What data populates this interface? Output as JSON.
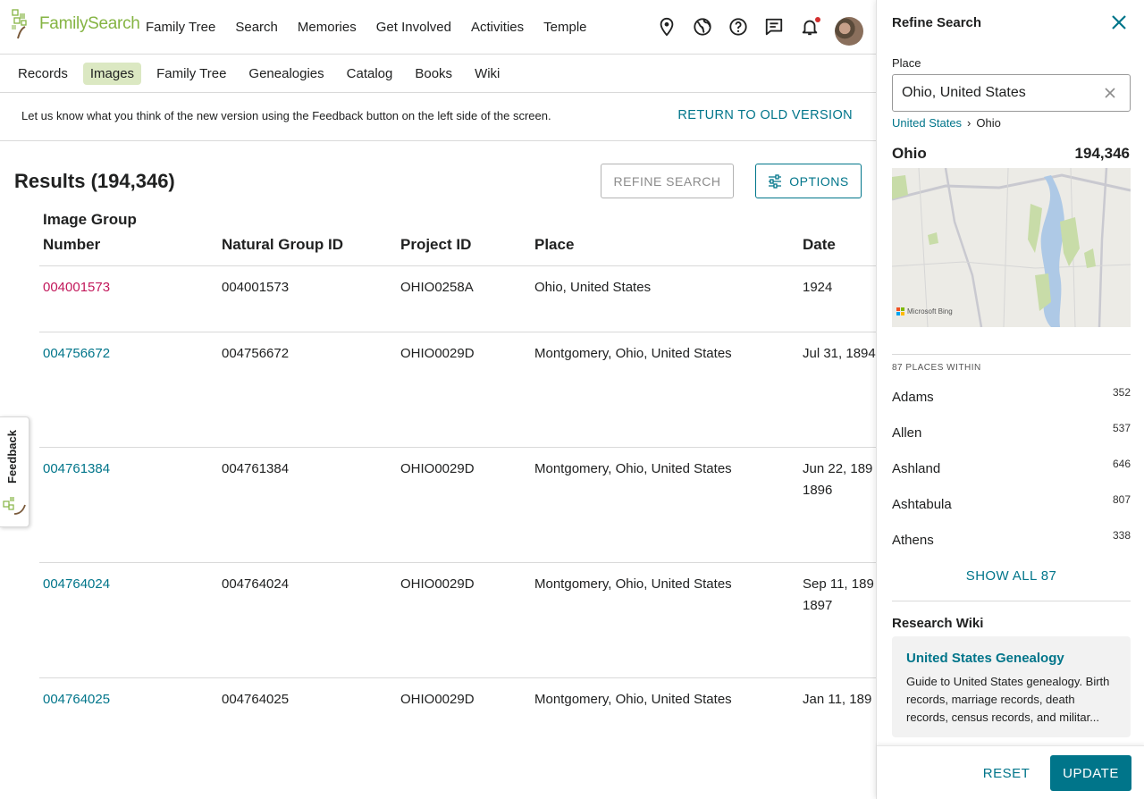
{
  "header": {
    "logo_text": "FamilySearch",
    "nav": [
      "Family Tree",
      "Search",
      "Memories",
      "Get Involved",
      "Activities",
      "Temple"
    ],
    "icons": [
      "location-pin-icon",
      "globe-icon",
      "help-icon",
      "messages-icon",
      "notifications-icon"
    ]
  },
  "subnav": {
    "items": [
      "Records",
      "Images",
      "Family Tree",
      "Genealogies",
      "Catalog",
      "Books",
      "Wiki"
    ],
    "active": "Images"
  },
  "banner": {
    "text": "Let us know what you think of the new version using the Feedback button on the left side of the screen.",
    "link": "RETURN TO OLD VERSION"
  },
  "results": {
    "title": "Results (194,346)",
    "refine_button": "REFINE SEARCH",
    "options_button": "OPTIONS",
    "columns": [
      "Image Group Number",
      "Natural Group ID",
      "Project ID",
      "Place",
      "Date"
    ],
    "rows": [
      {
        "group": "004001573",
        "natural": "004001573",
        "project": "OHIO0258A",
        "place": "Ohio, United States",
        "date": "1924",
        "date2": "",
        "visited": true
      },
      {
        "group": "004756672",
        "natural": "004756672",
        "project": "OHIO0029D",
        "place": "Montgomery, Ohio, United States",
        "date": "Jul 31, 1894",
        "date2": "",
        "visited": false
      },
      {
        "group": "004761384",
        "natural": "004761384",
        "project": "OHIO0029D",
        "place": "Montgomery, Ohio, United States",
        "date": "Jun 22, 189",
        "date2": "1896",
        "visited": false
      },
      {
        "group": "004764024",
        "natural": "004764024",
        "project": "OHIO0029D",
        "place": "Montgomery, Ohio, United States",
        "date": "Sep 11, 189",
        "date2": "1897",
        "visited": false
      },
      {
        "group": "004764025",
        "natural": "004764025",
        "project": "OHIO0029D",
        "place": "Montgomery, Ohio, United States",
        "date": "Jan 11, 189",
        "date2": "",
        "visited": false
      }
    ]
  },
  "feedback_tab": {
    "label": "Feedback"
  },
  "panel": {
    "title": "Refine Search",
    "place_label": "Place",
    "place_value": "Ohio, United States",
    "breadcrumb": {
      "parent": "United States",
      "separator": "›",
      "current": "Ohio"
    },
    "place_name": "Ohio",
    "place_count": "194,346",
    "map_brand": "Microsoft Bing",
    "places_within_label": "87 PLACES WITHIN",
    "counties": [
      {
        "name": "Adams",
        "count": "352"
      },
      {
        "name": "Allen",
        "count": "537"
      },
      {
        "name": "Ashland",
        "count": "646"
      },
      {
        "name": "Ashtabula",
        "count": "807"
      },
      {
        "name": "Athens",
        "count": "338"
      }
    ],
    "show_all": "SHOW ALL 87",
    "wiki_heading": "Research Wiki",
    "wiki_card_title": "United States Genealogy",
    "wiki_card_body": "Guide to United States genealogy. Birth records, marriage records, death records, census records, and militar...",
    "reset": "RESET",
    "update": "UPDATE"
  },
  "colors": {
    "link": "#00758a",
    "visited_link": "#c2185b",
    "active_tab": "#dbe8c2",
    "brand_green": "#85b443",
    "primary_button": "#00758a"
  }
}
